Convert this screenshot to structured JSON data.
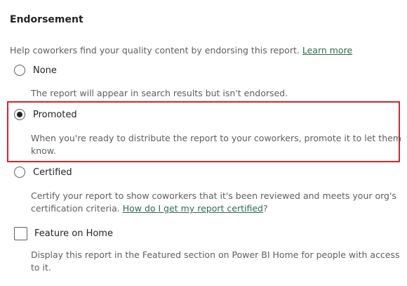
{
  "section": {
    "title": "Endorsement",
    "help_text": "Help coworkers find your quality content by endorsing this report.",
    "help_link": "Learn more"
  },
  "options": {
    "none": {
      "label": "None",
      "selected": false,
      "description": "The report will appear in search results but isn't endorsed."
    },
    "promoted": {
      "label": "Promoted",
      "selected": true,
      "description": "When you're ready to distribute the report to your coworkers, promote it to let them know."
    },
    "certified": {
      "label": "Certified",
      "selected": false,
      "description": "Certify your report to show coworkers that it's been reviewed and meets your org's certification criteria.",
      "link": "How do I get my report certified",
      "link_suffix": "?"
    }
  },
  "feature_home": {
    "label": "Feature on Home",
    "checked": false,
    "description": "Display this report in the Featured section on Power BI Home for people with access to it."
  },
  "colors": {
    "highlight_border": "#d9232d",
    "link": "#2d6b4f",
    "text_primary": "#252423",
    "text_secondary": "#605e5c"
  }
}
